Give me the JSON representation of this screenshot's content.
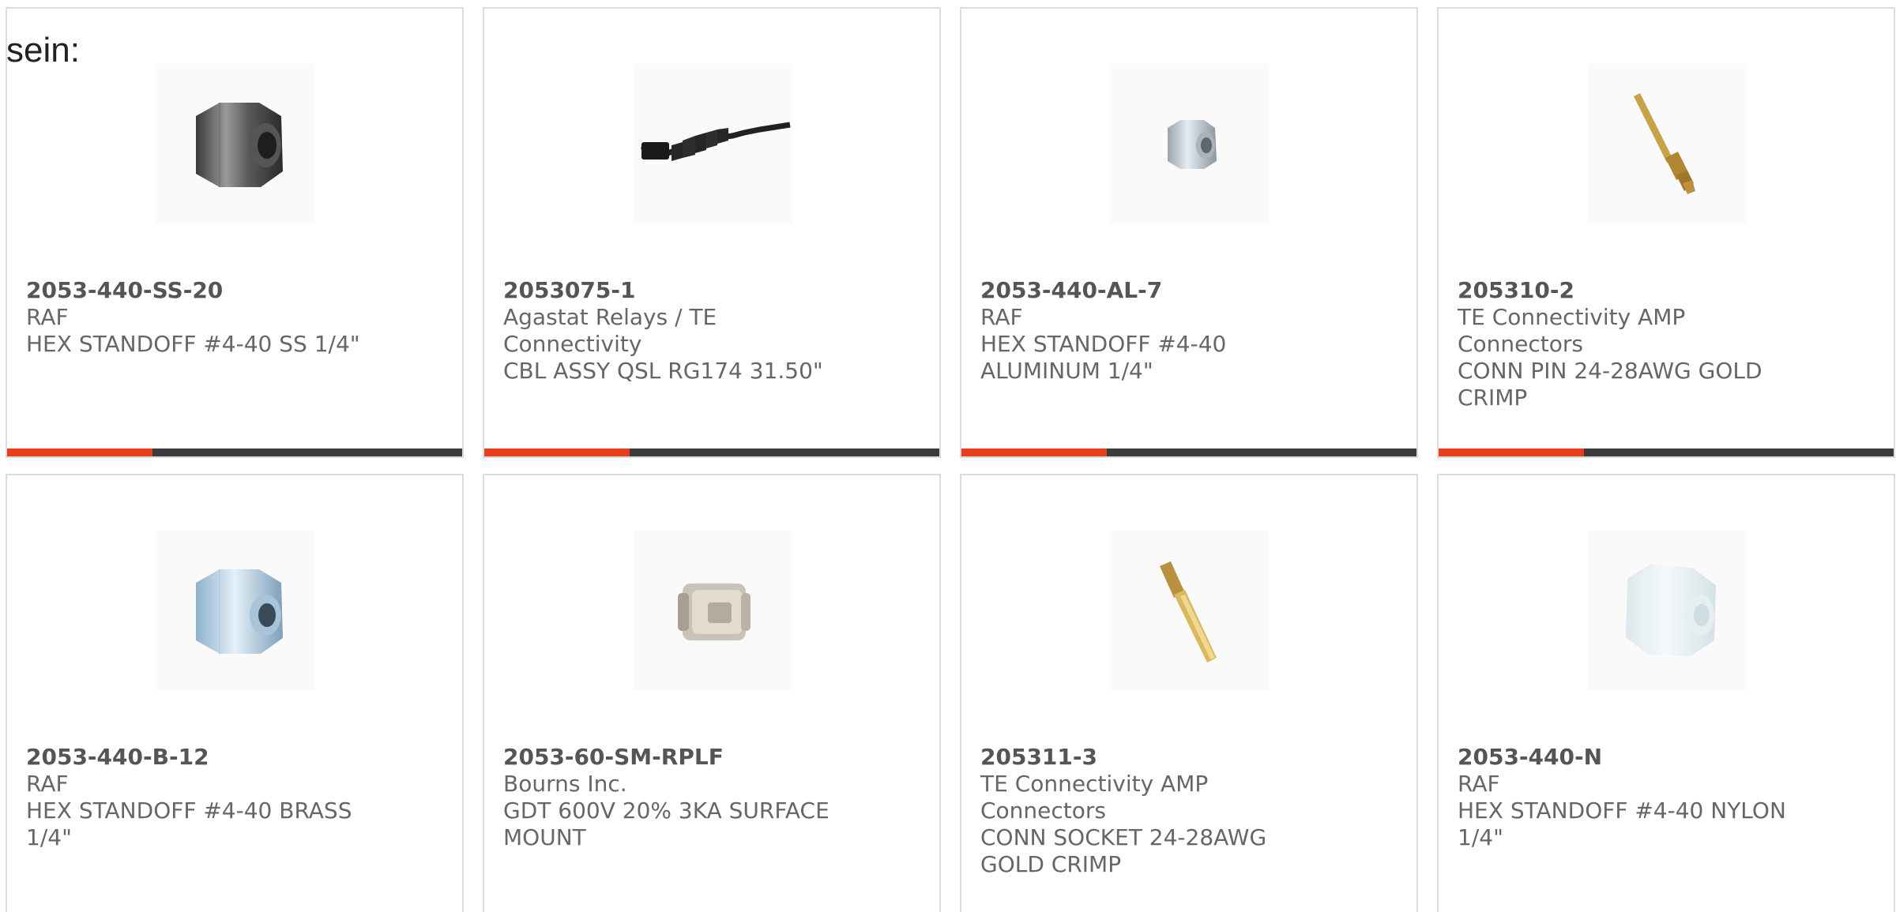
{
  "intro_text": "sein:",
  "accent_color": "#e8401c",
  "products": [
    {
      "part_number": "2053-440-SS-20",
      "manufacturer": "RAF",
      "description": "HEX STANDOFF #4-40 SS 1/4\"",
      "icon": "hex-standoff-steel-icon"
    },
    {
      "part_number": "2053075-1",
      "manufacturer": "Agastat Relays / TE Connectivity",
      "description": "CBL ASSY QSL RG174 31.50\"",
      "icon": "cable-assembly-icon"
    },
    {
      "part_number": "2053-440-AL-7",
      "manufacturer": "RAF",
      "description": "HEX STANDOFF #4-40 ALUMINUM 1/4\"",
      "icon": "hex-standoff-aluminum-icon"
    },
    {
      "part_number": "205310-2",
      "manufacturer": "TE Connectivity AMP Connectors",
      "description": "CONN PIN 24-28AWG GOLD CRIMP",
      "icon": "crimp-pin-icon"
    },
    {
      "part_number": "2053-440-B-12",
      "manufacturer": "RAF",
      "description": "HEX STANDOFF #4-40 BRASS 1/4\"",
      "icon": "hex-standoff-brass-icon"
    },
    {
      "part_number": "2053-60-SM-RPLF",
      "manufacturer": "Bourns Inc.",
      "description": "GDT 600V 20% 3KA SURFACE MOUNT",
      "icon": "gas-discharge-tube-icon"
    },
    {
      "part_number": "205311-3",
      "manufacturer": "TE Connectivity AMP Connectors",
      "description": "CONN SOCKET 24-28AWG GOLD CRIMP",
      "icon": "crimp-socket-icon"
    },
    {
      "part_number": "2053-440-N",
      "manufacturer": "RAF",
      "description": "HEX STANDOFF #4-40 NYLON 1/4\"",
      "icon": "hex-standoff-nylon-icon"
    }
  ]
}
